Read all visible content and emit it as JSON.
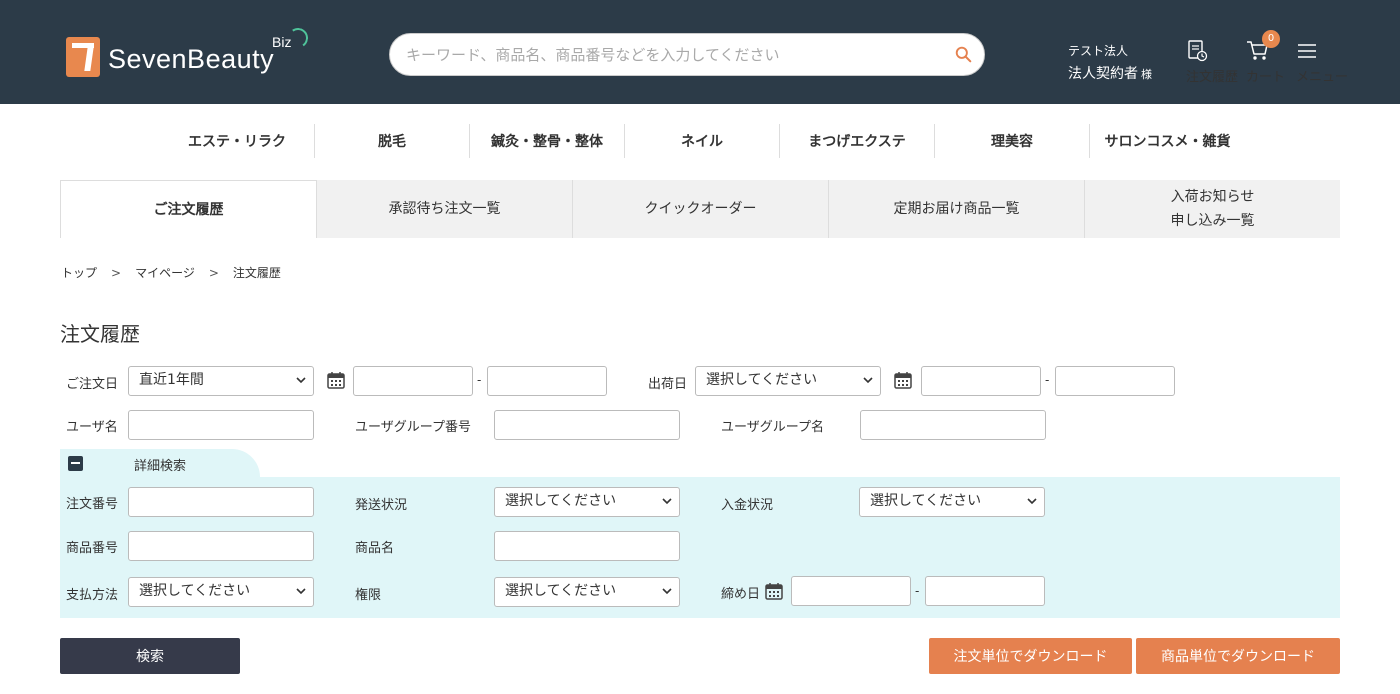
{
  "header": {
    "brand": "SevenBeauty",
    "brand_sup": "Biz",
    "search_placeholder": "キーワード、商品名、商品番号などを入力してください",
    "company": "テスト法人",
    "user_name": "法人契約者",
    "honorific": "様",
    "order_history_label": "注文履歴",
    "cart_label": "カート",
    "cart_count": "0",
    "menu_label": "メニュー"
  },
  "categories": [
    "エステ・リラク",
    "脱毛",
    "鍼灸・整骨・整体",
    "ネイル",
    "まつげエクステ",
    "理美容",
    "サロンコスメ・雑貨"
  ],
  "tabs": [
    "ご注文履歴",
    "承認待ち注文一覧",
    "クイックオーダー",
    "定期お届け商品一覧",
    "入荷お知らせ\n申し込み一覧"
  ],
  "breadcrumb": [
    "トップ",
    "マイページ",
    "注文履歴"
  ],
  "breadcrumb_sep": ">",
  "page_title": "注文履歴",
  "form": {
    "order_date_label": "ご注文日",
    "order_date_value": "直近1年間",
    "ship_date_label": "出荷日",
    "ship_date_value": "選択してください",
    "dash": "-",
    "user_name_label": "ユーザ名",
    "user_group_no_label": "ユーザグループ番号",
    "user_group_name_label": "ユーザグループ名",
    "detail_toggle_label": "詳細検索",
    "order_no_label": "注文番号",
    "shipping_status_label": "発送状況",
    "shipping_status_value": "選択してください",
    "payment_status_label": "入金状況",
    "payment_status_value": "選択してください",
    "product_no_label": "商品番号",
    "product_name_label": "商品名",
    "payment_method_label": "支払方法",
    "payment_method_value": "選択してください",
    "authority_label": "権限",
    "authority_value": "選択してください",
    "closing_date_label": "締め日"
  },
  "buttons": {
    "search": "検索",
    "download_by_order": "注文単位でダウンロード",
    "download_by_product": "商品単位でダウンロード"
  },
  "colors": {
    "header_bg": "#2c3b48",
    "accent": "#e5814f",
    "detail_bg": "#e0f6f8",
    "search_button": "#363a4a"
  }
}
